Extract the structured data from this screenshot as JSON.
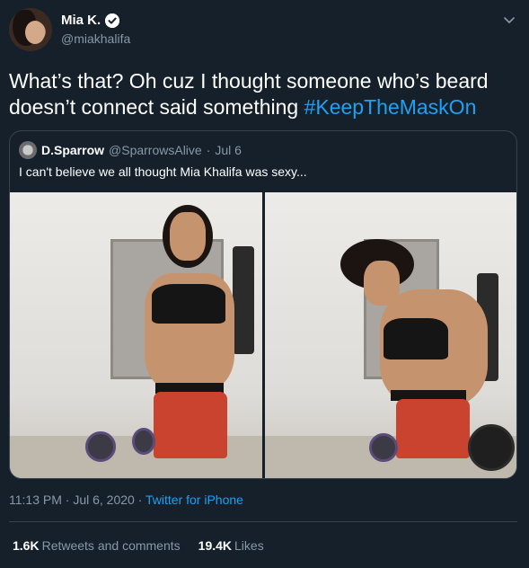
{
  "author": {
    "display_name": "Mia K.",
    "handle": "@miakhalifa",
    "verified_icon": "verified-badge-icon"
  },
  "tweet": {
    "text": "What’s that? Oh cuz I thought someone who’s beard doesn’t connect said something ",
    "hashtag": "#KeepTheMaskOn"
  },
  "quoted": {
    "display_name": "D.Sparrow",
    "handle": "@SparrowsAlive",
    "separator": "·",
    "date": "Jul 6",
    "text": "I can't believe we all thought Mia Khalifa was sexy..."
  },
  "footer": {
    "time": "11:13 PM · Jul 6, 2020 · ",
    "source": "Twitter for iPhone",
    "retweets_count": "1.6K",
    "retweets_label": "Retweets and comments",
    "likes_count": "19.4K",
    "likes_label": "Likes"
  },
  "colors": {
    "background": "#15202b",
    "accent": "#1da1f2",
    "muted": "#8899a6",
    "border": "#38444d"
  }
}
